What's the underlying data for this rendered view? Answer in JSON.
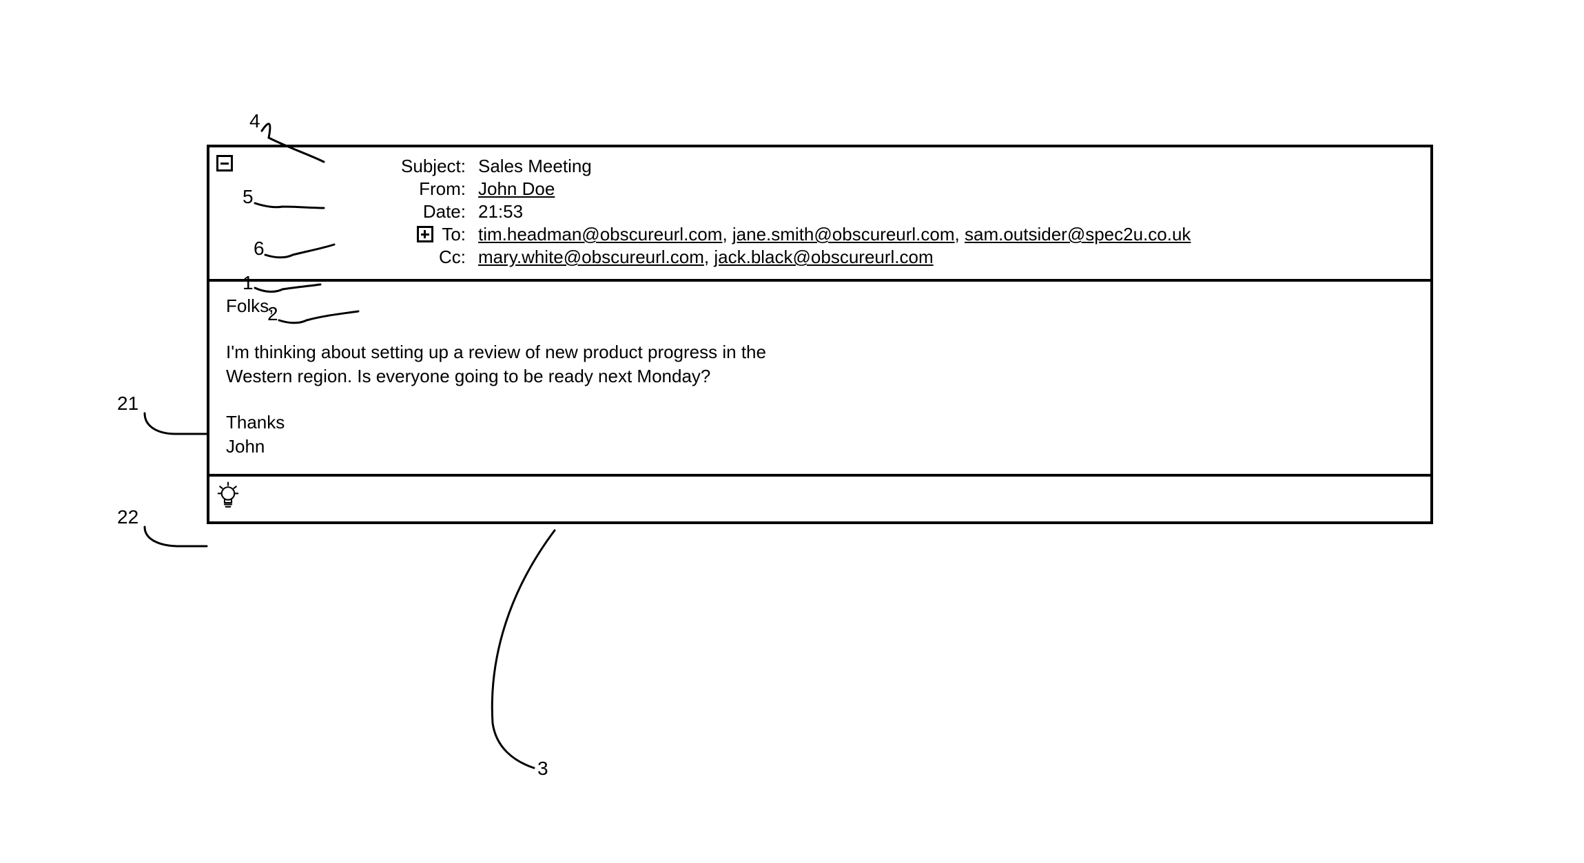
{
  "header": {
    "labels": {
      "subject": "Subject:",
      "from": "From:",
      "date": "Date:",
      "to": "To:",
      "cc": "Cc:"
    },
    "subject": "Sales Meeting",
    "from": "John Doe",
    "date": "21:53",
    "to": [
      "tim.headman@obscureurl.com",
      "jane.smith@obscureurl.com",
      "sam.outsider@spec2u.co.uk"
    ],
    "cc": [
      "mary.white@obscureurl.com",
      "jack.black@obscureurl.com"
    ]
  },
  "body": {
    "greeting": "Folks,",
    "para1_line1": "I'm thinking about setting up a review of new product progress in the",
    "para1_line2": "Western region. Is everyone going to be ready next Monday?",
    "closing_line1": "Thanks",
    "closing_line2": "John"
  },
  "callouts": {
    "c1": "1",
    "c2": "2",
    "c3": "3",
    "c4": "4",
    "c5": "5",
    "c6": "6",
    "c21": "21",
    "c22": "22"
  }
}
